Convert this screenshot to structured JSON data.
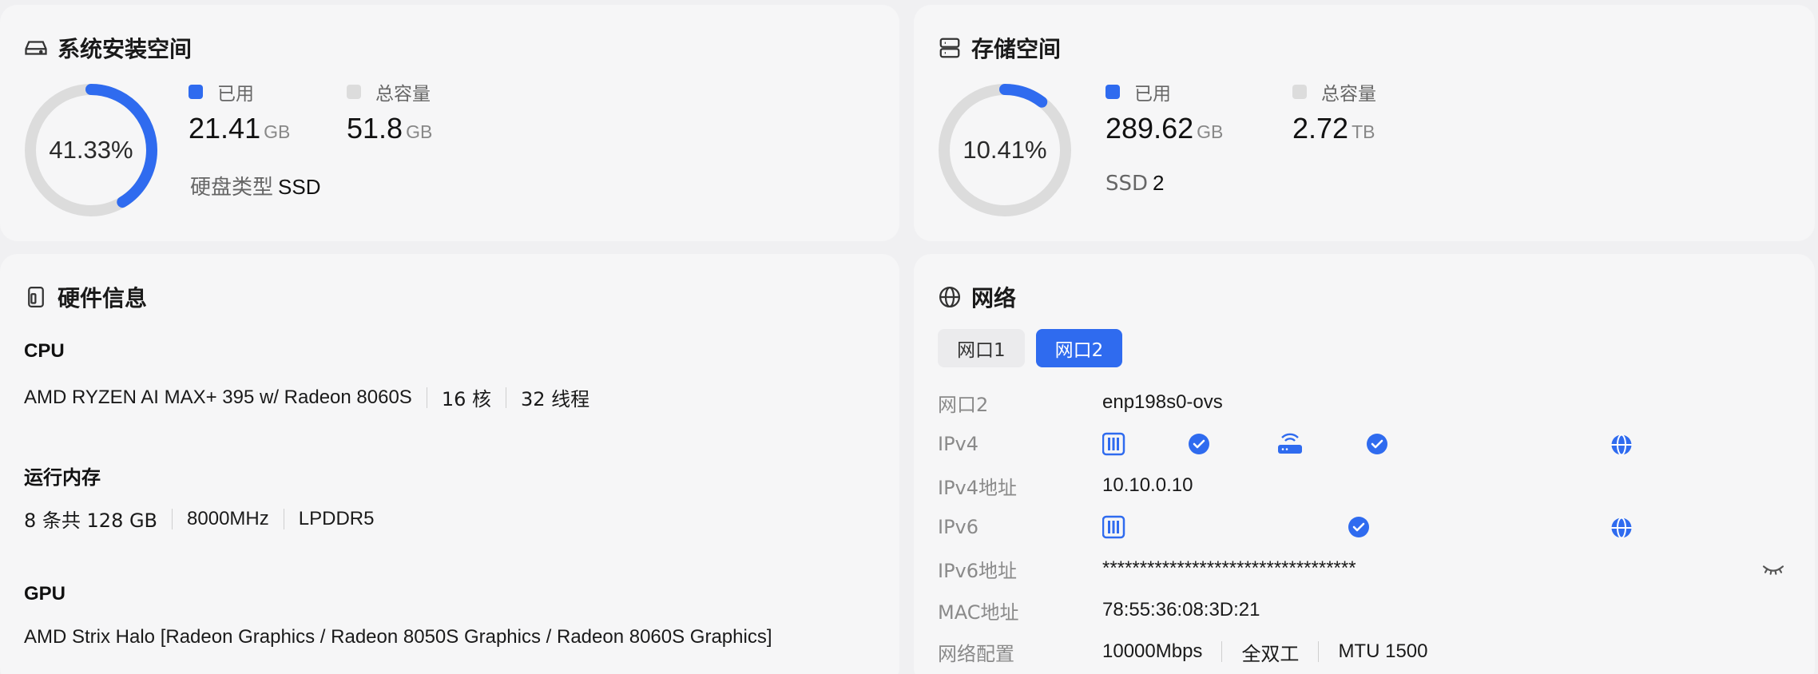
{
  "system_space": {
    "title": "系统安装空间",
    "percent": 0.4133,
    "percent_label": "41.33%",
    "used_label": "已用",
    "used_value": "21.41",
    "used_unit": "GB",
    "total_label": "总容量",
    "total_value": "51.8",
    "total_unit": "GB",
    "disk_type_label": "硬盘类型",
    "disk_type_value": "SSD"
  },
  "storage_space": {
    "title": "存储空间",
    "percent": 0.1041,
    "percent_label": "10.41%",
    "used_label": "已用",
    "used_value": "289.62",
    "used_unit": "GB",
    "total_label": "总容量",
    "total_value": "2.72",
    "total_unit": "TB",
    "ssd_label": "SSD",
    "ssd_count": "2"
  },
  "hardware": {
    "title": "硬件信息",
    "cpu_label": "CPU",
    "cpu_model": "AMD RYZEN AI MAX+ 395 w/ Radeon 8060S",
    "cpu_cores": "16 核",
    "cpu_threads": "32 线程",
    "memory_label": "运行内存",
    "memory_size": "8 条共 128 GB",
    "memory_speed": "8000MHz",
    "memory_type": "LPDDR5",
    "gpu_label": "GPU",
    "gpu_model": "AMD Strix Halo [Radeon Graphics / Radeon 8050S Graphics / Radeon 8060S Graphics]"
  },
  "network": {
    "title": "网络",
    "tabs": [
      "网口1",
      "网口2"
    ],
    "active_tab": 1,
    "rows": {
      "port_key": "网口2",
      "port_value": "enp198s0-ovs",
      "ipv4_key": "IPv4",
      "ipv4_addr_key": "IPv4地址",
      "ipv4_addr_value": "10.10.0.10",
      "ipv6_key": "IPv6",
      "ipv6_addr_key": "IPv6地址",
      "ipv6_addr_value": "**********************************",
      "mac_key": "MAC地址",
      "mac_value": "78:55:36:08:3D:21",
      "config_key": "网络配置",
      "speed": "10000Mbps",
      "duplex": "全双工",
      "mtu": "MTU 1500"
    }
  },
  "colors": {
    "accent": "#2f6bef",
    "track": "#dcdcdc",
    "check": "#2f6bef"
  },
  "icons": {
    "system": "hard-drive-icon",
    "storage": "server-icon",
    "hardware": "device-icon",
    "network": "globe-icon",
    "eye": "eye-closed-icon"
  }
}
